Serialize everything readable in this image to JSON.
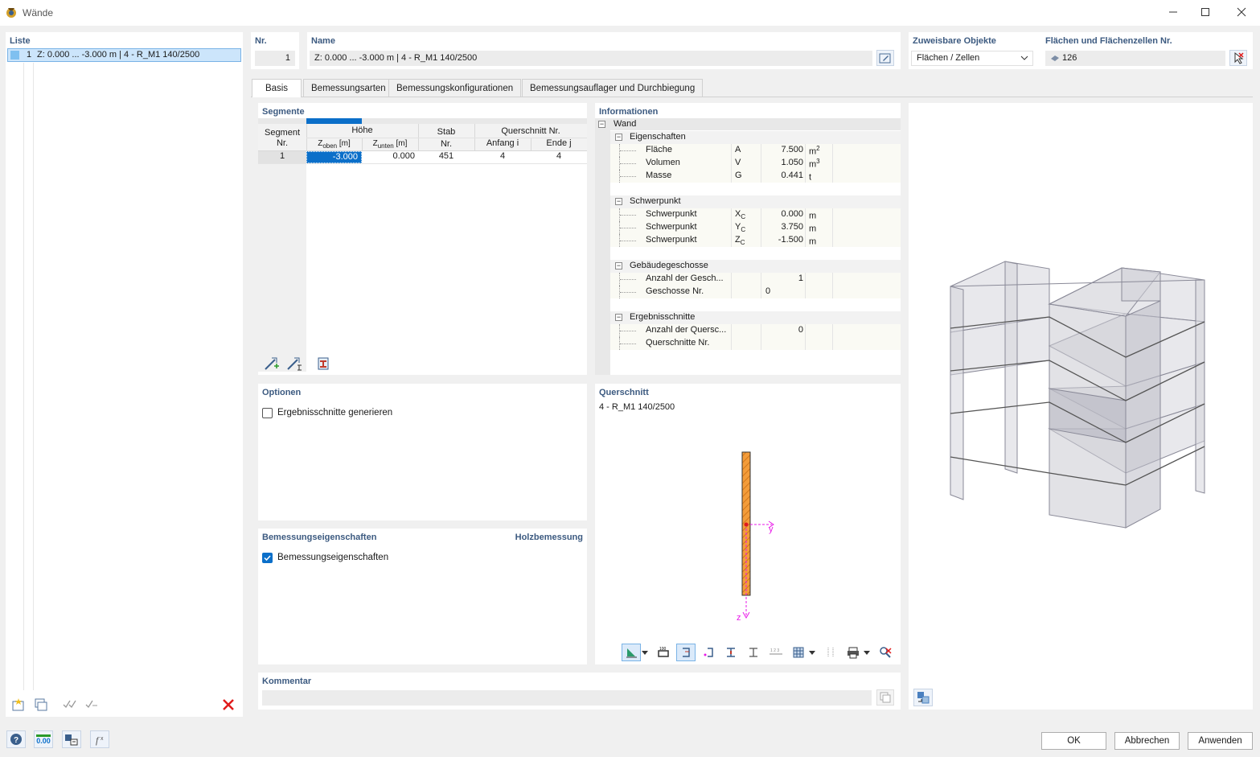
{
  "window": {
    "title": "Wände"
  },
  "list": {
    "title": "Liste",
    "items": [
      {
        "nr": "1",
        "label": "Z: 0.000 ... -3.000 m | 4 - R_M1 140/2500"
      }
    ]
  },
  "header": {
    "nr_label": "Nr.",
    "nr_value": "1",
    "name_label": "Name",
    "name_value": "Z: 0.000 ... -3.000  m | 4 - R_M1 140/2500",
    "assign_label": "Zuweisbare Objekte",
    "assign_value": "Flächen / Zellen",
    "surfaces_label": "Flächen und Flächenzellen Nr.",
    "surfaces_value": "126"
  },
  "tabs": [
    "Basis",
    "Bemessungsarten",
    "Bemessungskonfigurationen",
    "Bemessungsauflager und Durchbiegung"
  ],
  "segments": {
    "title": "Segmente",
    "h_segment": "Segment",
    "h_nr": "Nr.",
    "h_hoehe": "Höhe",
    "h_zoben": "Z",
    "h_zoben_sub": "oben",
    "h_zoben_unit": " [m]",
    "h_zunten": "Z",
    "h_zunten_sub": "unten",
    "h_zunten_unit": " [m]",
    "h_stab": "Stab",
    "h_stab_nr": "Nr.",
    "h_qs": "Querschnitt Nr.",
    "h_anfang": "Anfang i",
    "h_ende": "Ende j",
    "rows": [
      {
        "nr": "1",
        "zoben": "-3.000",
        "zunten": "0.000",
        "stab": "451",
        "anfang": "4",
        "ende": "4"
      }
    ]
  },
  "info": {
    "title": "Informationen",
    "root": "Wand",
    "groups": [
      {
        "name": "Eigenschaften",
        "rows": [
          {
            "label": "Fläche",
            "sym": "A",
            "sub": "",
            "value": "7.500",
            "unit": "m",
            "sup": "2"
          },
          {
            "label": "Volumen",
            "sym": "V",
            "sub": "",
            "value": "1.050",
            "unit": "m",
            "sup": "3"
          },
          {
            "label": "Masse",
            "sym": "G",
            "sub": "",
            "value": "0.441",
            "unit": "t",
            "sup": ""
          }
        ]
      },
      {
        "name": "Schwerpunkt",
        "rows": [
          {
            "label": "Schwerpunkt",
            "sym": "X",
            "sub": "C",
            "value": "0.000",
            "unit": "m",
            "sup": ""
          },
          {
            "label": "Schwerpunkt",
            "sym": "Y",
            "sub": "C",
            "value": "3.750",
            "unit": "m",
            "sup": ""
          },
          {
            "label": "Schwerpunkt",
            "sym": "Z",
            "sub": "C",
            "value": "-1.500",
            "unit": "m",
            "sup": ""
          }
        ]
      },
      {
        "name": "Gebäudegeschosse",
        "rows": [
          {
            "label": "Anzahl der Gesch...",
            "sym": "",
            "sub": "",
            "value": "1",
            "unit": "",
            "sup": ""
          },
          {
            "label": "Geschosse Nr.",
            "sym": "",
            "sub": "",
            "value": "0",
            "unit": "",
            "sup": "",
            "left": true
          }
        ]
      },
      {
        "name": "Ergebnisschnitte",
        "rows": [
          {
            "label": "Anzahl der Quersc...",
            "sym": "",
            "sub": "",
            "value": "0",
            "unit": "",
            "sup": ""
          },
          {
            "label": "Querschnitte Nr.",
            "sym": "",
            "sub": "",
            "value": "",
            "unit": "",
            "sup": ""
          }
        ]
      }
    ]
  },
  "options": {
    "title": "Optionen",
    "generate_sections": "Ergebnisschnitte generieren",
    "generate_checked": false
  },
  "design": {
    "title": "Bemessungseigenschaften",
    "right": "Holzbemessung",
    "checkbox": "Bemessungseigenschaften",
    "checked": true
  },
  "crosssection": {
    "title": "Querschnitt",
    "name": "4 - R_M1 140/2500",
    "axis_y": "y",
    "axis_z": "z",
    "icon_100": "100",
    "icon_123": "1 2 3"
  },
  "comment": {
    "title": "Kommentar",
    "value": ""
  },
  "footer": {
    "units_value": "0.00",
    "ok": "OK",
    "cancel": "Abbrechen",
    "apply": "Anwenden"
  },
  "colors": {
    "accent": "#0b6fc9",
    "title": "#3c5a80",
    "wall": "#f39c3a",
    "axis": "#e81ae8",
    "close": "#e01b1b"
  }
}
